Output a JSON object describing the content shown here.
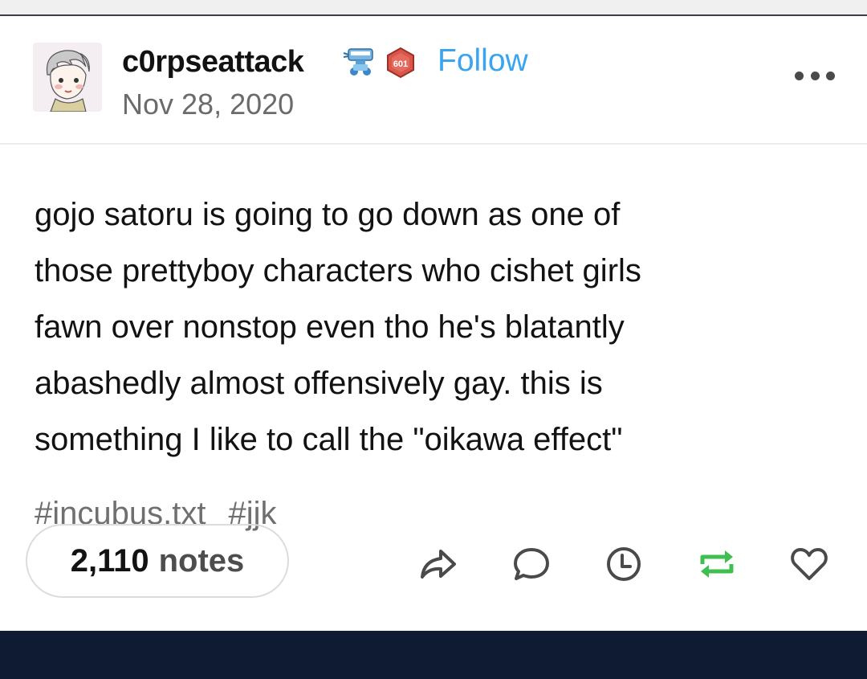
{
  "post": {
    "author": {
      "username": "c0rpseattack",
      "follow_label": "Follow",
      "badge_text": "601"
    },
    "date": "Nov 28, 2020",
    "body_lines": [
      "gojo satoru is going to go down as one of",
      "those prettyboy characters who cishet girls",
      "fawn over nonstop even tho he's blatantly",
      "abashedly almost offensively gay. this is",
      "something I like to call the \"oikawa effect\""
    ],
    "tags": [
      "#incubus.txt",
      "#jjk"
    ],
    "notes": {
      "count": "2,110",
      "label": "notes"
    },
    "actions": [
      {
        "name": "share-icon",
        "color": "#4a4a4a"
      },
      {
        "name": "reply-icon",
        "color": "#4a4a4a"
      },
      {
        "name": "schedule-icon",
        "color": "#4a4a4a"
      },
      {
        "name": "reblog-icon",
        "color": "#3fbf4f"
      },
      {
        "name": "like-icon",
        "color": "#4a4a4a"
      }
    ]
  },
  "colors": {
    "follow": "#3aa4f0",
    "reblog_active": "#3fbf4f",
    "footer_bar": "#0f1b33"
  }
}
